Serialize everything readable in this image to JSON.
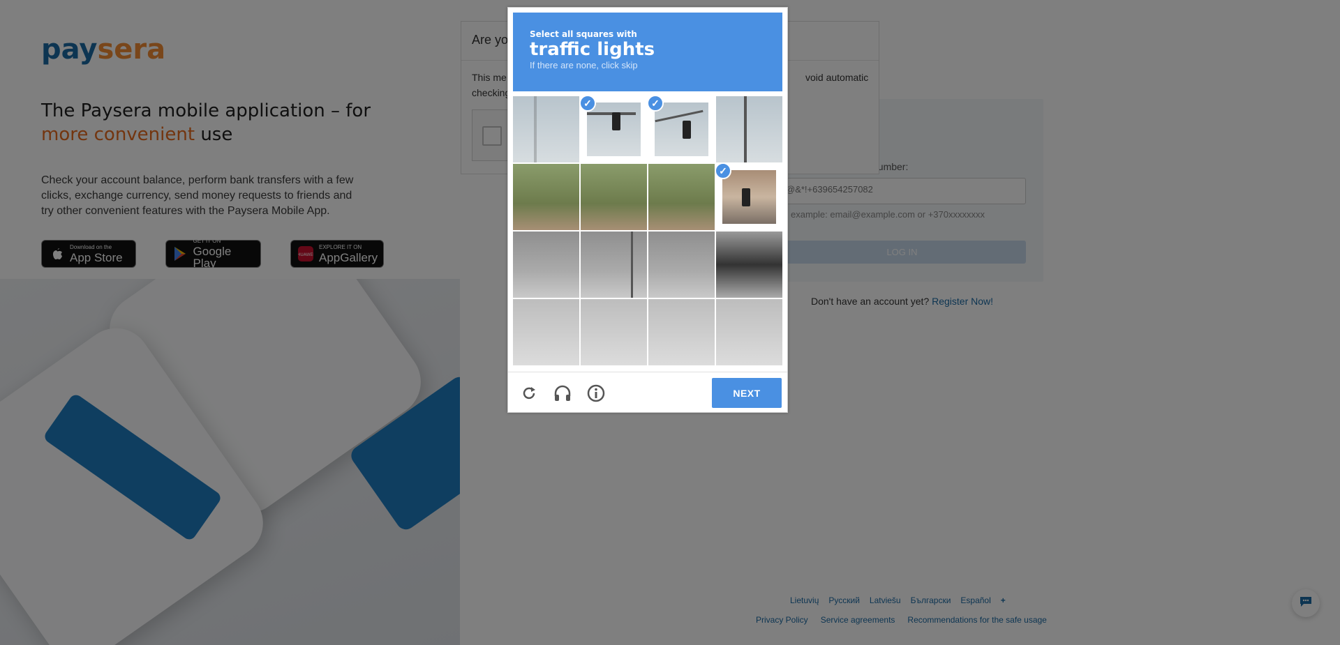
{
  "left": {
    "logo_main": "pay",
    "logo_accent": "sera",
    "title_pre": "The Paysera mobile application – for",
    "title_hl": "more convenient",
    "title_post": " use",
    "description": "Check your account balance, perform bank transfers with a few clicks, exchange currency, send money requests to friends and try other convenient features with the Paysera Mobile App.",
    "stores": [
      {
        "small": "Download on the",
        "big": "App Store",
        "icon": "apple-icon"
      },
      {
        "small": "GET IT ON",
        "big": "Google Play",
        "icon": "google-play-icon"
      },
      {
        "small": "EXPLORE IT ON",
        "big": "AppGallery",
        "icon": "huawei-icon"
      }
    ]
  },
  "login": {
    "label": "number:",
    "input_value": "@&*!+639654257082",
    "hint": "example: email@example.com or +370xxxxxxxx",
    "button": "LOG IN",
    "register_text": "Don't have an account yet?",
    "register_link": "Register Now!"
  },
  "footer": {
    "languages": [
      "Lietuvių",
      "Русский",
      "Latviešu",
      "Български",
      "Español",
      "+"
    ],
    "links": [
      "Privacy Policy",
      "Service agreements",
      "Recommendations for the safe usage"
    ]
  },
  "dialog": {
    "title": "Are yo",
    "message_start": "This me",
    "message_end": "void automatic",
    "message_line2": "checking"
  },
  "captcha": {
    "instruction": "Select all squares with",
    "target": "traffic lights",
    "sub": "If there are none, click skip",
    "next": "NEXT",
    "selected_tiles": [
      1,
      2,
      7
    ]
  }
}
